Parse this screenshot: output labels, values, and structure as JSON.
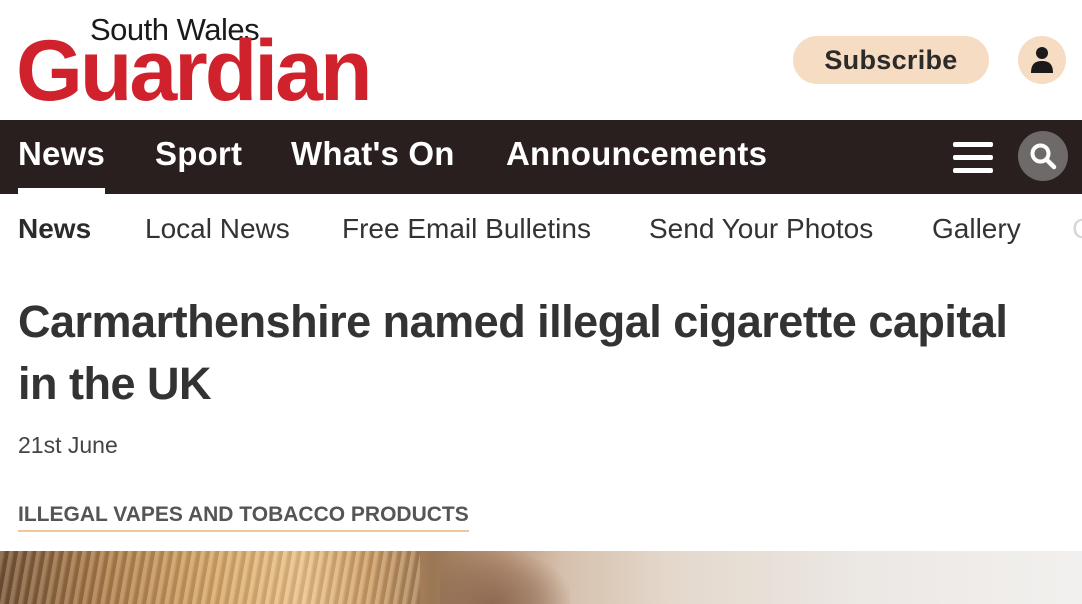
{
  "brand": {
    "top_line": "South Wales",
    "name": "Guardian",
    "color": "#d0222c"
  },
  "header": {
    "subscribe_label": "Subscribe",
    "account_icon": "person-icon"
  },
  "main_nav": {
    "items": [
      {
        "label": "News",
        "active": true
      },
      {
        "label": "Sport",
        "active": false
      },
      {
        "label": "What's On",
        "active": false
      },
      {
        "label": "Announcements",
        "active": false
      }
    ],
    "menu_icon": "hamburger-icon",
    "search_icon": "search-icon",
    "background": "#2a1f1f"
  },
  "sub_nav": {
    "items": [
      {
        "label": "News",
        "active": true
      },
      {
        "label": "Local News",
        "active": false
      },
      {
        "label": "Free Email Bulletins",
        "active": false
      },
      {
        "label": "Send Your Photos",
        "active": false
      },
      {
        "label": "Gallery",
        "active": false
      },
      {
        "label": "C",
        "active": false
      }
    ]
  },
  "article": {
    "headline": "Carmarthenshire named illegal cigarette capital in the UK",
    "date": "21st June",
    "topic": "ILLEGAL VAPES AND TOBACCO PRODUCTS"
  },
  "colors": {
    "accent_peach": "#f6dcc2",
    "topic_underline": "#f2c59a"
  }
}
